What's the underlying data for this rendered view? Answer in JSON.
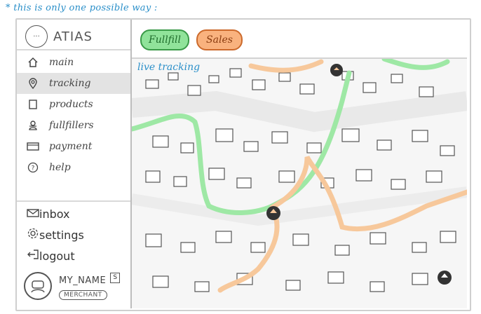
{
  "note": "* this is only one possible way :",
  "app": {
    "logo_icon": "···",
    "name": "ATIAS"
  },
  "menu": [
    {
      "label": "main",
      "icon": "home-icon"
    },
    {
      "label": "tracking",
      "icon": "location-pin-icon",
      "active": true
    },
    {
      "label": "products",
      "icon": "box-icon"
    },
    {
      "label": "fullfillers",
      "icon": "person-icon"
    },
    {
      "label": "payment",
      "icon": "wallet-icon"
    },
    {
      "label": "help",
      "icon": "help-icon"
    }
  ],
  "menu_bottom": [
    {
      "label": "inbox",
      "icon": "mail-icon"
    },
    {
      "label": "settings",
      "icon": "gear-icon"
    },
    {
      "label": "logout",
      "icon": "logout-icon"
    }
  ],
  "user": {
    "name": "MY_NAME",
    "badge": "S",
    "role": "MERCHANT"
  },
  "filters": {
    "fulfill": "Fullfill",
    "sales": "Sales"
  },
  "map": {
    "title": "live tracking"
  },
  "colors": {
    "fulfill_route": "#9ee8a5",
    "sales_route": "#f7c89b",
    "accent_note": "#2a8fc9"
  }
}
